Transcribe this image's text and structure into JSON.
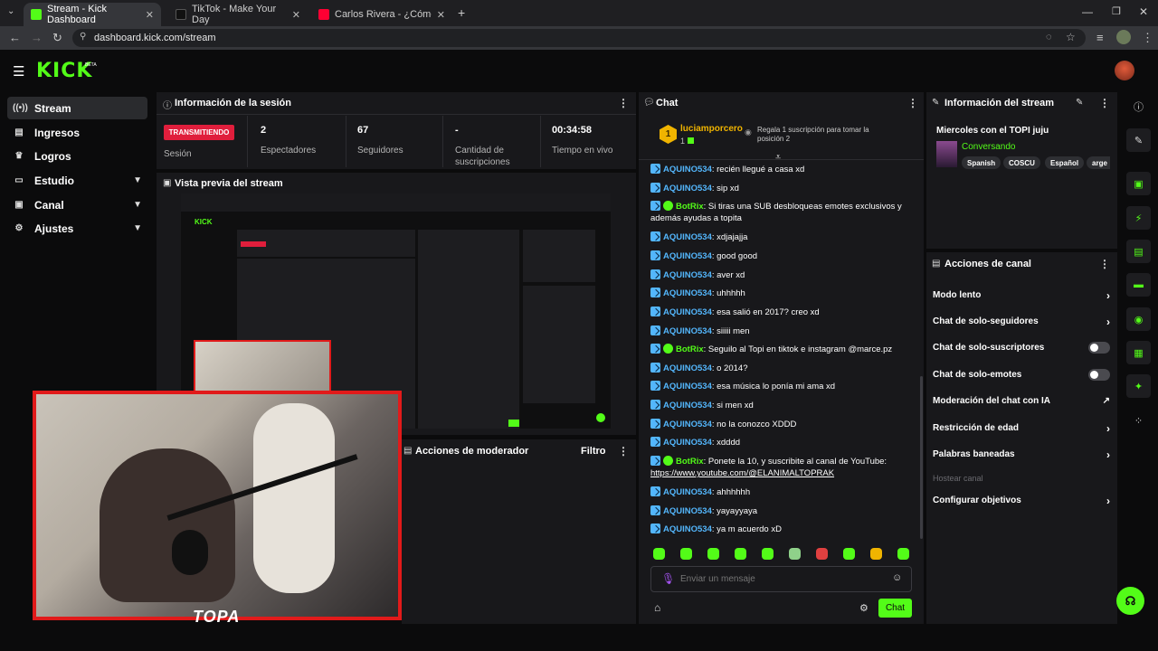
{
  "browser": {
    "tabs": [
      {
        "title": "Stream - Kick Dashboard"
      },
      {
        "title": "TikTok - Make Your Day"
      },
      {
        "title": "Carlos Rivera - ¿Cómo Pagarte..."
      }
    ],
    "url": "dashboard.kick.com/stream"
  },
  "header": {
    "logo": "KICK",
    "beta": "BETA"
  },
  "sidebar": {
    "items": [
      {
        "label": "Stream",
        "icon": "broadcast-icon"
      },
      {
        "label": "Ingresos",
        "icon": "revenue-icon"
      },
      {
        "label": "Logros",
        "icon": "trophy-icon"
      },
      {
        "label": "Estudio",
        "icon": "studio-icon"
      },
      {
        "label": "Canal",
        "icon": "channel-icon"
      },
      {
        "label": "Ajustes",
        "icon": "gear-icon"
      }
    ]
  },
  "session": {
    "title": "Información de la sesión",
    "status": "TRANSMITIENDO",
    "status_label": "Sesión",
    "viewers_value": "2",
    "viewers_label": "Espectadores",
    "followers_value": "67",
    "followers_label": "Seguidores",
    "subs_value": "-",
    "subs_label": "Cantidad de suscripciones",
    "time_value": "00:34:58",
    "time_label": "Tiempo en vivo"
  },
  "preview": {
    "title": "Vista previa del stream",
    "overlay_text": "TOPA"
  },
  "moderator": {
    "title": "Acciones de moderador",
    "filter": "Filtro"
  },
  "chat": {
    "title": "Chat",
    "top_user": "luciamporcero",
    "top_count": "1",
    "top_rank": "1",
    "gift_prompt": "Regala 1 suscripción para tomar la posición 2",
    "messages": [
      {
        "user": "AQUINO534",
        "text": ": recién llegué a casa xd"
      },
      {
        "user": "AQUINO534",
        "text": ": sip xd"
      },
      {
        "user": "BotRix",
        "text": ": Si tiras una SUB desbloqueas emotes exclusivos y además ayudas a topita"
      },
      {
        "user": "AQUINO534",
        "text": ": xdjajajja"
      },
      {
        "user": "AQUINO534",
        "text": ": good good"
      },
      {
        "user": "AQUINO534",
        "text": ": aver xd"
      },
      {
        "user": "AQUINO534",
        "text": ": uhhhhh"
      },
      {
        "user": "AQUINO534",
        "text": ": esa salió en 2017? creo xd"
      },
      {
        "user": "AQUINO534",
        "text": ": siiiii men"
      },
      {
        "user": "BotRix",
        "text": ": Seguilo al Topi en tiktok e instagram @marce.pz"
      },
      {
        "user": "AQUINO534",
        "text": ": o 2014?"
      },
      {
        "user": "AQUINO534",
        "text": ": esa música lo ponía mi ama xd"
      },
      {
        "user": "AQUINO534",
        "text": ": si men xd"
      },
      {
        "user": "AQUINO534",
        "text": ": no la conozco XDDD"
      },
      {
        "user": "AQUINO534",
        "text": ": xdddd"
      },
      {
        "user": "BotRix",
        "text": ": Ponete la 10, y suscribite al canal de YouTube:",
        "link": "https://www.youtube.com/@ELANIMALTOPRAK"
      },
      {
        "user": "AQUINO534",
        "text": ": ahhhhhh"
      },
      {
        "user": "AQUINO534",
        "text": ": yayayyaya"
      },
      {
        "user": "AQUINO534",
        "text": ": ya m acuerdo xD"
      }
    ],
    "input_placeholder": "Enviar un mensaje",
    "send_label": "Chat"
  },
  "stream_info": {
    "title": "Información del stream",
    "stream_title": "Miercoles con el TOPI juju",
    "category": "Conversando",
    "tags": [
      "Spanish",
      "COSCU",
      "Español",
      "arge"
    ]
  },
  "channel_actions": {
    "title": "Acciones de canal",
    "items": [
      {
        "label": "Modo lento",
        "control": "chevron"
      },
      {
        "label": "Chat de solo-seguidores",
        "control": "chevron"
      },
      {
        "label": "Chat de solo-suscriptores",
        "control": "toggle",
        "on": false
      },
      {
        "label": "Chat de solo-emotes",
        "control": "toggle",
        "on": false
      },
      {
        "label": "Moderación del chat con IA",
        "control": "external"
      },
      {
        "label": "Restricción de edad",
        "control": "chevron"
      },
      {
        "label": "Palabras baneadas",
        "control": "chevron"
      },
      {
        "label": "Hostear canal",
        "control": "none",
        "disabled": true
      },
      {
        "label": "Configurar objetivos",
        "control": "chevron"
      }
    ]
  },
  "colors": {
    "accent": "#53fc18",
    "live": "#e01e3c",
    "username": "#53b6fc",
    "panel": "#18181b"
  }
}
